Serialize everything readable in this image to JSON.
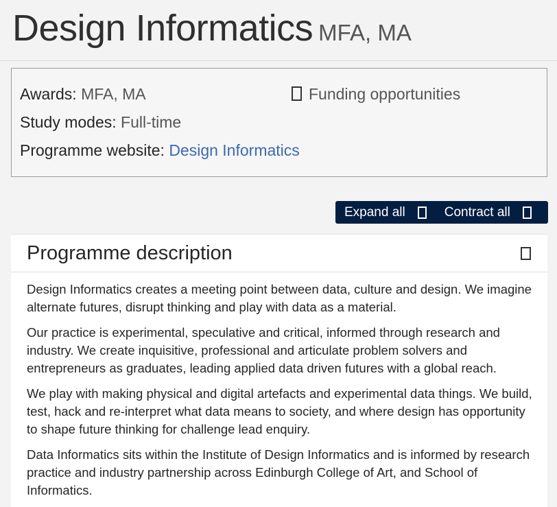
{
  "header": {
    "title": "Design Informatics",
    "subtitle": "MFA, MA"
  },
  "info": {
    "awards_label": "Awards:",
    "awards_value": "MFA, MA",
    "study_modes_label": "Study modes:",
    "study_modes_value": "Full-time",
    "website_label": "Programme website:",
    "website_link": "Design Informatics",
    "funding_link": "Funding opportunities"
  },
  "toolbar": {
    "expand_label": "Expand all",
    "contract_label": "Contract all"
  },
  "panel": {
    "title": "Programme description",
    "paragraphs": [
      "Design Informatics creates a meeting point between data, culture and design. We imagine alternate futures, disrupt thinking and play with data as a material.",
      "Our practice is experimental, speculative and critical, informed through research and industry. We create inquisitive, professional and articulate problem solvers and entrepreneurs as graduates, leading applied data driven futures with a global reach.",
      "We play with making physical and digital artefacts and experimental data things. We build, test, hack and re-interpret what data means to society, and where design has opportunity to shape future thinking for challenge lead enquiry.",
      "Data Informatics sits within the Institute of Design Informatics and is informed by research practice and industry partnership across Edinburgh College of Art, and School of Informatics."
    ]
  },
  "colors": {
    "link": "#3c69b1",
    "toolbar_bg": "#041e42",
    "page_bg": "#f3f3f3"
  },
  "icons": {
    "funding": "checkbox-icon",
    "expand": "box-icon",
    "contract": "box-icon",
    "panel_toggle": "box-icon"
  }
}
